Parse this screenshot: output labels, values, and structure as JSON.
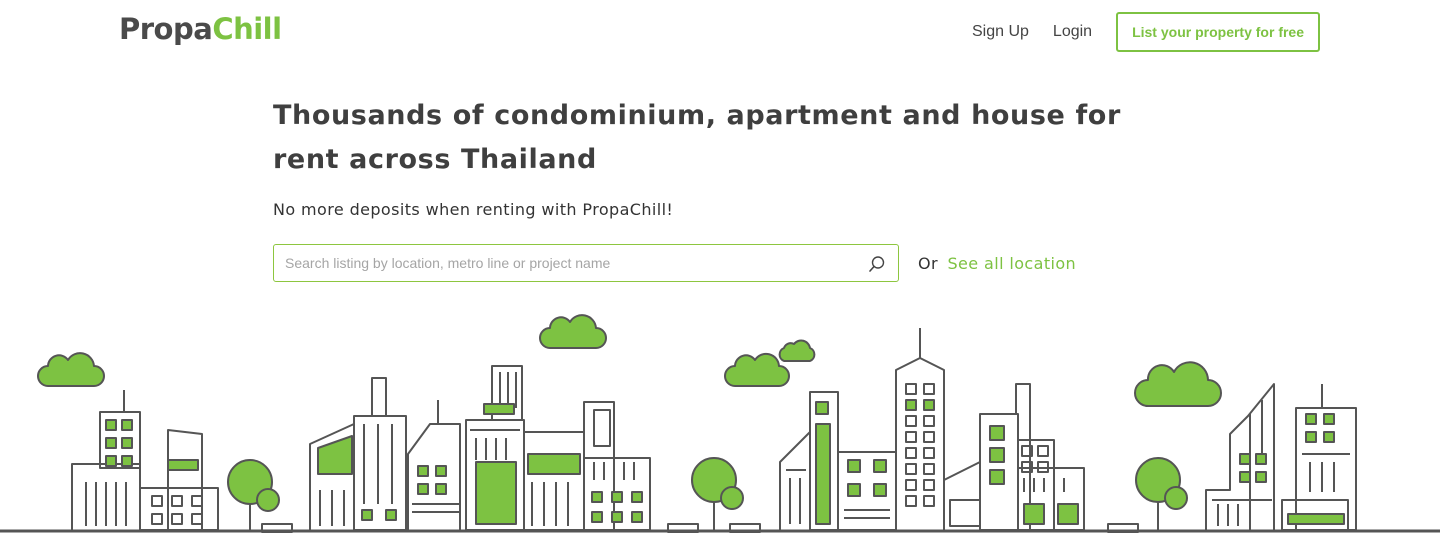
{
  "brand": {
    "name_part1": "Propa",
    "name_part2": "Chill",
    "accent_color": "#7dc242"
  },
  "nav": {
    "signup_label": "Sign Up",
    "login_label": "Login",
    "cta_label": "List your property for free"
  },
  "hero": {
    "title": "Thousands of condominium, apartment and house for rent across Thailand",
    "subtitle": "No more deposits when renting with PropaChill!"
  },
  "search": {
    "placeholder": "Search listing by location, metro line or project name",
    "value": "",
    "icon": "search-icon"
  },
  "alt_link": {
    "prefix": "Or",
    "label": "See all location"
  },
  "illustration": {
    "name": "city-skyline-illustration",
    "line_color": "#555555",
    "fill_color": "#7dc242"
  }
}
